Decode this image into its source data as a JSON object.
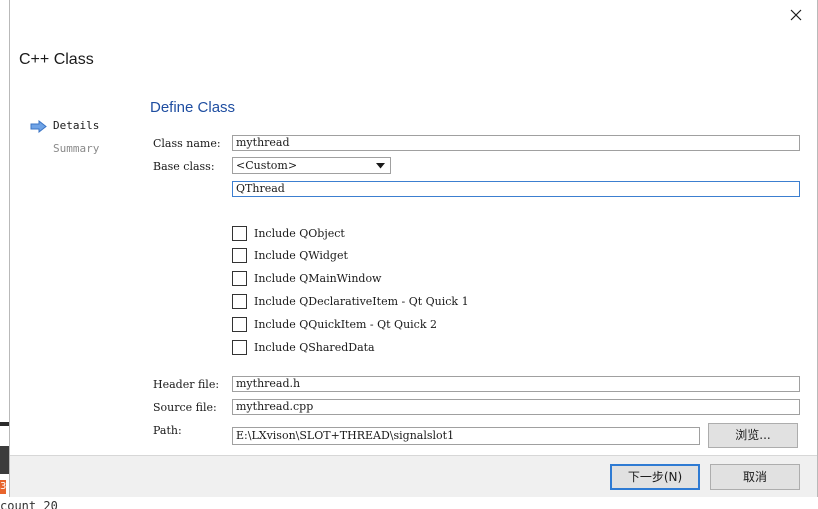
{
  "window": {
    "title": "C++ Class"
  },
  "sidebar": {
    "items": [
      {
        "label": "Details",
        "active": true
      },
      {
        "label": "Summary",
        "active": false
      }
    ]
  },
  "page": {
    "section_title": "Define Class"
  },
  "form": {
    "class_name_label": "Class name:",
    "class_name_value": "mythread",
    "base_class_label": "Base class:",
    "base_class_selected": "<Custom>",
    "custom_base_value": "QThread",
    "checkboxes": [
      {
        "label": "Include QObject",
        "checked": false
      },
      {
        "label": "Include QWidget",
        "checked": false
      },
      {
        "label": "Include QMainWindow",
        "checked": false
      },
      {
        "label": "Include QDeclarativeItem - Qt Quick 1",
        "checked": false
      },
      {
        "label": "Include QQuickItem - Qt Quick 2",
        "checked": false
      },
      {
        "label": "Include QSharedData",
        "checked": false
      }
    ],
    "header_file_label": "Header file:",
    "header_file_value": "mythread.h",
    "source_file_label": "Source file:",
    "source_file_value": "mythread.cpp",
    "path_label": "Path:",
    "path_value": "E:\\LXvison\\SLOT+THREAD\\signalslot1",
    "browse_label": "浏览..."
  },
  "footer": {
    "next_label": "下一步(N)",
    "cancel_label": "取消"
  },
  "background": {
    "snippet_text": "count 20",
    "badge_text": "3"
  },
  "colors": {
    "accent_title": "#1f4ea1",
    "default_button_border": "#2f7bd3",
    "sidebar_arrow": "#4a86d8"
  }
}
